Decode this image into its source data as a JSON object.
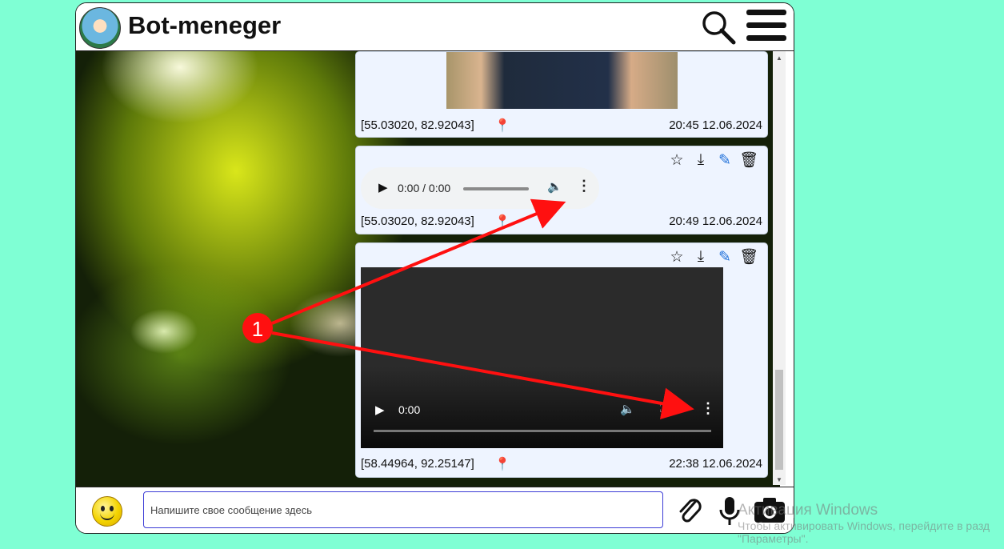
{
  "header": {
    "title": "Bot-meneger",
    "logo_icon": "robot-avatar-icon",
    "search_icon": "search-icon",
    "menu_icon": "hamburger-menu-icon"
  },
  "messages": [
    {
      "type": "image",
      "coords": "[55.03020, 82.92043]",
      "timestamp": "20:45 12.06.2024"
    },
    {
      "type": "audio",
      "coords": "[55.03020, 82.92043]",
      "timestamp": "20:49 12.06.2024",
      "player_time": "0:00 / 0:00"
    },
    {
      "type": "video",
      "coords": "[58.44964, 92.25147]",
      "timestamp": "22:38 12.06.2024",
      "player_time": "0:00"
    }
  ],
  "message_actions": [
    "star-icon",
    "download-icon",
    "edit-pencil-icon",
    "delete-icon"
  ],
  "footer": {
    "input_placeholder": "Напишите свое сообщение здесь",
    "emoji_icon": "smiley-icon",
    "attach_icon": "paperclip-icon",
    "mic_icon": "microphone-icon",
    "camera_icon": "camera-icon"
  },
  "annotation": {
    "label": "1",
    "color": "#ff1010"
  },
  "watermark": {
    "title": "Активация Windows",
    "line1": "Чтобы активировать Windows, перейдите в разд",
    "line2": "\"Параметры\"."
  },
  "colors": {
    "page_bg": "#7fffd4",
    "message_bg": "#eef4ff",
    "accent_border": "#3b3bd6"
  }
}
